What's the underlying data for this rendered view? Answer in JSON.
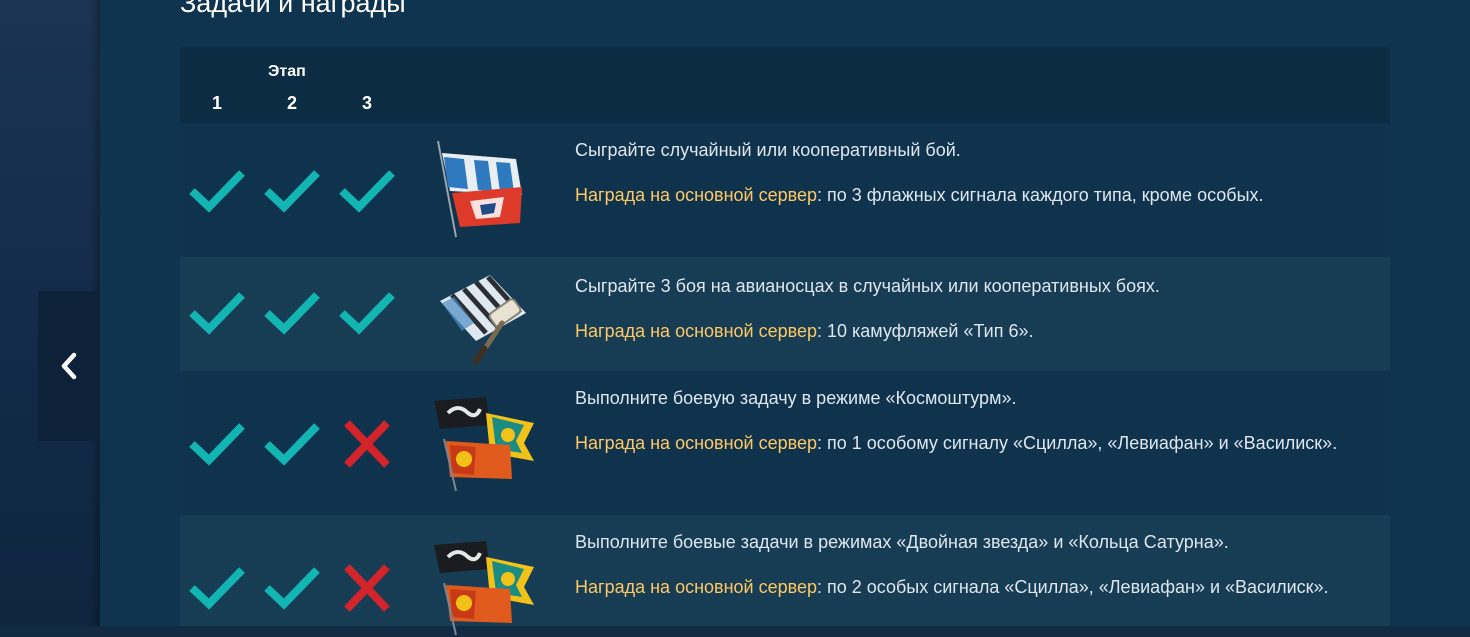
{
  "section": {
    "title": "Задачи и награды"
  },
  "table": {
    "stage_header": "Этап",
    "stage_numbers": [
      "1",
      "2",
      "3"
    ]
  },
  "rows": [
    {
      "task": "Сыграйте случайный или кооперативный бой.",
      "reward_label": "Награда на основной сервер",
      "reward_text": ": по 3 флажных сигнала каждого типа, кроме особых.",
      "stages": [
        "check",
        "check",
        "check"
      ],
      "icon": "signal-flags-icon"
    },
    {
      "task": "Сыграйте 3 боя на авианосцах в случайных или кооперативных боях.",
      "reward_label": "Награда на основной сервер",
      "reward_text": ": 10 камуфляжей «Тип 6».",
      "stages": [
        "check",
        "check",
        "check"
      ],
      "icon": "camouflage-roller-icon"
    },
    {
      "task": "Выполните боевую задачу в режиме «Космоштурм».",
      "reward_label": "Награда на основной сервер",
      "reward_text": ": по 1 особому сигналу «Сцилла», «Левиафан» и «Василиск».",
      "stages": [
        "check",
        "check",
        "cross"
      ],
      "icon": "special-signals-icon"
    },
    {
      "task": "Выполните боевые задачи в режимах «Двойная звезда» и «Кольца Сатурна».",
      "reward_label": "Награда на основной сервер",
      "reward_text": ": по 2 особых сигнала «Сцилла», «Левиафан» и «Василиск».",
      "stages": [
        "check",
        "check",
        "cross"
      ],
      "icon": "special-signals-icon"
    }
  ],
  "colors": {
    "check": "#13b5b3",
    "cross": "#d3232b",
    "reward_label": "#ffc864",
    "text": "#dfe6ec"
  }
}
